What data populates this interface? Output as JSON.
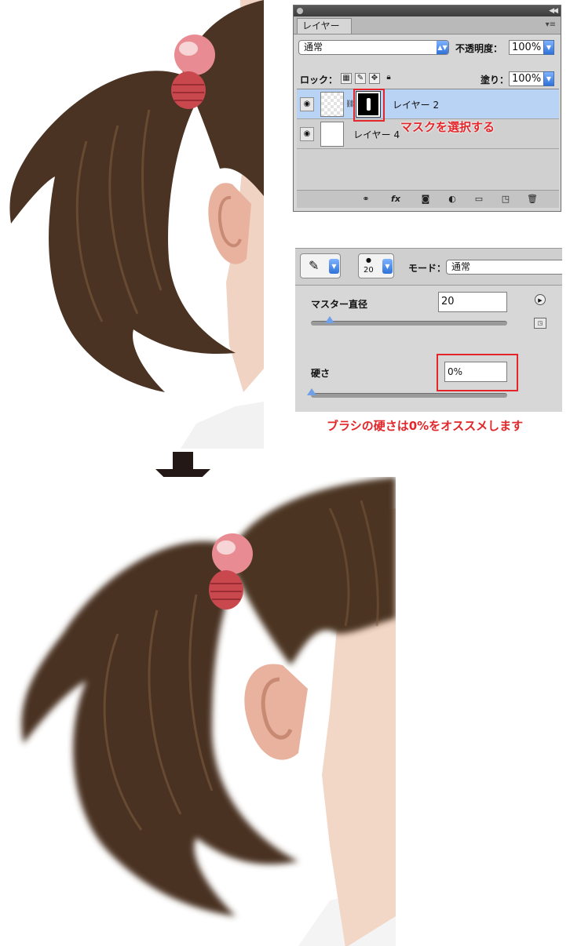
{
  "layers_panel": {
    "tab_label": "レイヤー",
    "blend_mode": "通常",
    "opacity_label": "不透明度：",
    "opacity_value": "100%",
    "lock_label": "ロック：",
    "fill_label": "塗り：",
    "fill_value": "100%",
    "layers": [
      {
        "name": "レイヤー 2",
        "selected": true,
        "has_mask": true
      },
      {
        "name": "レイヤー 4",
        "selected": false,
        "has_mask": false
      }
    ],
    "annotation": "マスクを選択する"
  },
  "brush_panel": {
    "brush_size_preview": "20",
    "mode_label": "モード：",
    "mode_value": "通常",
    "master_diameter_label": "マスター直径",
    "master_diameter_value": "20",
    "hardness_label": "硬さ",
    "hardness_value": "0%",
    "annotation": "ブラシの硬さは0%をオススメします"
  },
  "colors": {
    "annotation_red": "#e2262a",
    "selection_blue": "#b9d3f5",
    "hair_brown": "#4a3322"
  },
  "icons": [
    "eye-icon",
    "chain-link-icon",
    "fx-icon",
    "mask-icon",
    "adjustment-icon",
    "folder-icon",
    "new-layer-icon",
    "trash-icon",
    "brush-icon",
    "down-arrow-icon"
  ]
}
